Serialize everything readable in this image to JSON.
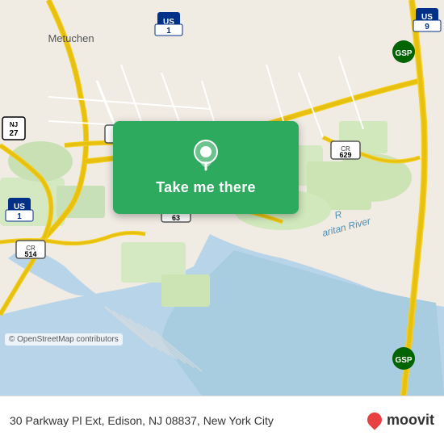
{
  "map": {
    "alt": "Map of Edison, NJ area showing streets and waterways"
  },
  "overlay": {
    "button_label": "Take me there",
    "pin_alt": "location-pin"
  },
  "bottom_bar": {
    "address": "30 Parkway Pl Ext, Edison, NJ 08837,",
    "city": "New York City",
    "attribution": "© OpenStreetMap contributors"
  },
  "moovit": {
    "logo_text": "moovit"
  }
}
